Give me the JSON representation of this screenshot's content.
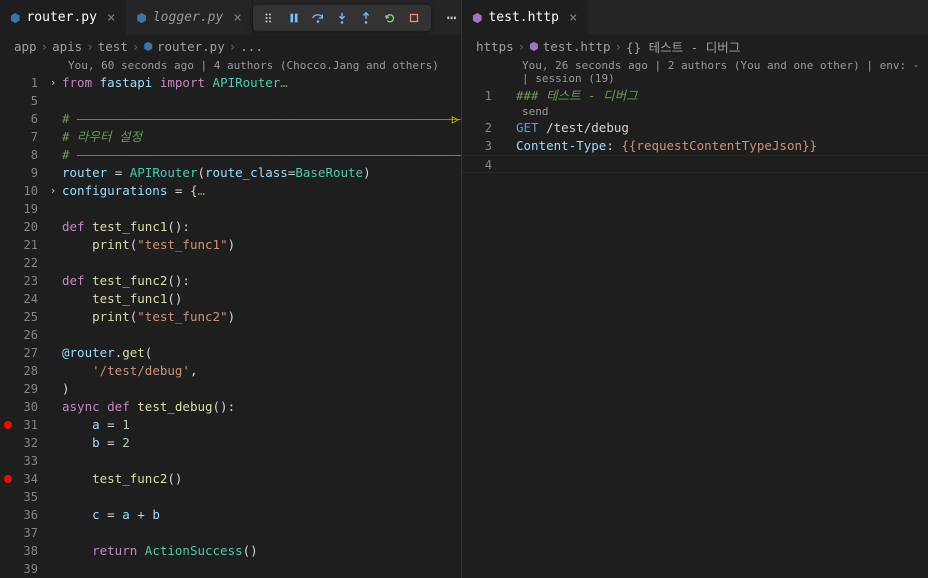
{
  "left": {
    "tabs": [
      {
        "name": "router.py",
        "active": true
      },
      {
        "name": "logger.py",
        "active": false,
        "italic": true
      }
    ],
    "breadcrumb": [
      "app",
      "apis",
      "test",
      "router.py",
      "..."
    ],
    "codelens": "You, 60 seconds ago | 4 authors (Chocco.Jang and others)",
    "lines": [
      {
        "n": 1,
        "fold": true,
        "html": "<span class='kw'>from</span> <span class='var'>fastapi</span> <span class='kw'>import</span> <span class='cls'>APIRouter</span><span class='cmt2'>…</span>"
      },
      {
        "n": 5,
        "html": ""
      },
      {
        "n": 6,
        "html": "<span class='cmt'># ––––––––––––––––––––––––––––––––––––––––––––––––––––––</span>",
        "exec": true
      },
      {
        "n": 7,
        "html": "<span class='cmt'># 라우터 설정</span>"
      },
      {
        "n": 8,
        "html": "<span class='cmt'># ––––––––––––––––––––––––––––––––––––––––––––––––––––––</span>"
      },
      {
        "n": 9,
        "html": "<span class='var'>router</span> <span class='op'>=</span> <span class='cls'>APIRouter</span>(<span class='param'>route_class</span><span class='op'>=</span><span class='cls'>BaseRoute</span>)"
      },
      {
        "n": 10,
        "fold": true,
        "html": "<span class='var'>configurations</span> <span class='op'>=</span> {<span class='cmt2'>…</span>"
      },
      {
        "n": 19,
        "html": ""
      },
      {
        "n": 20,
        "html": "<span class='kw'>def</span> <span class='fn'>test_func1</span>():"
      },
      {
        "n": 21,
        "html": "    <span class='fn'>print</span>(<span class='str'>\"test_func1\"</span>)"
      },
      {
        "n": 22,
        "html": ""
      },
      {
        "n": 23,
        "html": "<span class='kw'>def</span> <span class='fn'>test_func2</span>():"
      },
      {
        "n": 24,
        "html": "    <span class='fn'>test_func1</span>()"
      },
      {
        "n": 25,
        "html": "    <span class='fn'>print</span>(<span class='str'>\"test_func2\"</span>)"
      },
      {
        "n": 26,
        "html": ""
      },
      {
        "n": 27,
        "html": "<span class='var'>@router</span>.<span class='fn'>get</span>("
      },
      {
        "n": 28,
        "html": "    <span class='str'>'/test/debug'</span>,"
      },
      {
        "n": 29,
        "html": ")"
      },
      {
        "n": 30,
        "html": "<span class='kw'>async def</span> <span class='fn'>test_debug</span>():"
      },
      {
        "n": 31,
        "bp": true,
        "html": "    <span class='var'>a</span> <span class='op'>=</span> <span class='num'>1</span>"
      },
      {
        "n": 32,
        "html": "    <span class='var'>b</span> <span class='op'>=</span> <span class='num'>2</span>"
      },
      {
        "n": 33,
        "html": ""
      },
      {
        "n": 34,
        "bp": true,
        "html": "    <span class='fn'>test_func2</span>()"
      },
      {
        "n": 35,
        "html": ""
      },
      {
        "n": 36,
        "html": "    <span class='var'>c</span> <span class='op'>=</span> <span class='var'>a</span> <span class='op'>+</span> <span class='var'>b</span>"
      },
      {
        "n": 37,
        "html": ""
      },
      {
        "n": 38,
        "html": "    <span class='kw'>return</span> <span class='cls'>ActionSuccess</span>()"
      },
      {
        "n": 39,
        "html": ""
      }
    ]
  },
  "right": {
    "tabs": [
      {
        "name": "test.http",
        "active": true
      }
    ],
    "breadcrumb": [
      "https",
      "test.http",
      "{} 테스트 - 디버그"
    ],
    "codelens": "You, 26 seconds ago | 2 authors (You and one other) | env: - | session (19)",
    "sendlabel": "send",
    "lines": [
      {
        "n": 1,
        "html": "<span class='cmt'>### 테스트 - 디버그</span>"
      },
      {
        "n": 2,
        "html": "<span class='meth'>GET</span> <span class='op'>/test/debug</span>"
      },
      {
        "n": 3,
        "html": "<span class='var'>Content-Type</span><span class='op'>:</span> <span class='str'>{{requestContentTypeJson}}</span>"
      },
      {
        "n": 4,
        "html": "",
        "current": true
      }
    ]
  },
  "debug_buttons": [
    "grip",
    "pause",
    "step-over",
    "step-into",
    "step-out",
    "restart",
    "stop"
  ]
}
